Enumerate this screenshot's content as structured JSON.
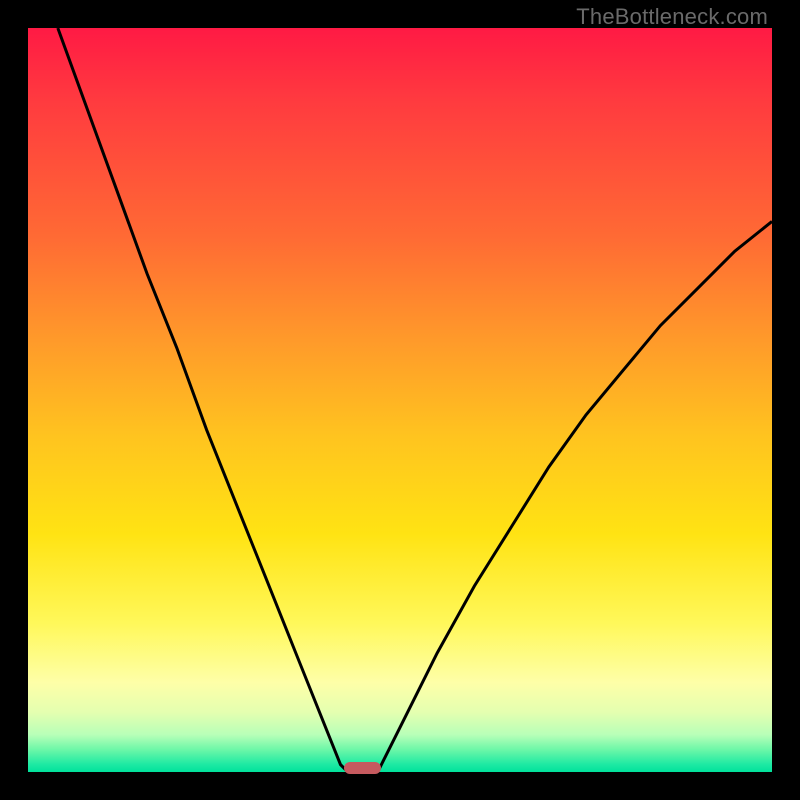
{
  "watermark": "TheBottleneck.com",
  "chart_data": {
    "type": "line",
    "title": "",
    "xlabel": "",
    "ylabel": "",
    "xlim": [
      0,
      100
    ],
    "ylim": [
      0,
      100
    ],
    "grid": false,
    "legend": false,
    "background": "rainbow-gradient-red-to-green",
    "series": [
      {
        "name": "left-curve",
        "x": [
          4,
          8,
          12,
          16,
          20,
          24,
          28,
          32,
          36,
          40,
          42,
          43
        ],
        "values": [
          100,
          89,
          78,
          67,
          57,
          46,
          36,
          26,
          16,
          6,
          1,
          0
        ]
      },
      {
        "name": "right-curve",
        "x": [
          47,
          50,
          55,
          60,
          65,
          70,
          75,
          80,
          85,
          90,
          95,
          100
        ],
        "values": [
          0,
          6,
          16,
          25,
          33,
          41,
          48,
          54,
          60,
          65,
          70,
          74
        ]
      }
    ],
    "marker": {
      "x_center": 45,
      "width_pct": 5,
      "y": 0,
      "color": "#c65a5f"
    }
  },
  "colors": {
    "frame": "#000000",
    "curve": "#000000",
    "marker": "#c65a5f",
    "watermark": "#6a6a6a"
  }
}
